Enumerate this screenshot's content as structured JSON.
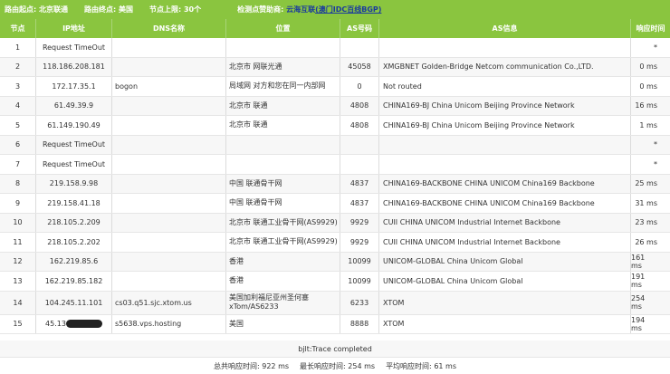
{
  "topbar": {
    "start_label": "路由起点: 北京联通",
    "end_label": "路由终点: 美国",
    "nodes_label": "节点上限: 30个",
    "sponsor_prefix": "检测点赞助商:",
    "sponsor_name": "云海互联",
    "sponsor_desc": "(澳门IDC百线BGP)"
  },
  "headers": [
    "节点",
    "IP地址",
    "DNS名称",
    "位置",
    "AS号码",
    "AS信息",
    "响应时间"
  ],
  "rows": [
    {
      "hop": "1",
      "ip": "Request TimeOut",
      "dns": "",
      "location": "",
      "as": "",
      "asinfo": "",
      "time": "*"
    },
    {
      "hop": "2",
      "ip": "118.186.208.181",
      "dns": "",
      "location": "北京市 网联光通",
      "as": "45058",
      "asinfo": "XMGBNET Golden-Bridge Netcom communication Co.,LTD.",
      "time": "0 ms"
    },
    {
      "hop": "3",
      "ip": "172.17.35.1",
      "dns": "bogon",
      "location": "局域网 对方和您在同一内部网",
      "as": "0",
      "asinfo": "Not routed",
      "time": "0 ms"
    },
    {
      "hop": "4",
      "ip": "61.49.39.9",
      "dns": "",
      "location": "北京市 联通",
      "as": "4808",
      "asinfo": "CHINA169-BJ China Unicom Beijing Province Network",
      "time": "16 ms"
    },
    {
      "hop": "5",
      "ip": "61.149.190.49",
      "dns": "",
      "location": "北京市 联通",
      "as": "4808",
      "asinfo": "CHINA169-BJ China Unicom Beijing Province Network",
      "time": "1 ms"
    },
    {
      "hop": "6",
      "ip": "Request TimeOut",
      "dns": "",
      "location": "",
      "as": "",
      "asinfo": "",
      "time": "*"
    },
    {
      "hop": "7",
      "ip": "Request TimeOut",
      "dns": "",
      "location": "",
      "as": "",
      "asinfo": "",
      "time": "*"
    },
    {
      "hop": "8",
      "ip": "219.158.9.98",
      "dns": "",
      "location": "中国 联通骨干网",
      "as": "4837",
      "asinfo": "CHINA169-BACKBONE CHINA UNICOM China169 Backbone",
      "time": "25 ms"
    },
    {
      "hop": "9",
      "ip": "219.158.41.18",
      "dns": "",
      "location": "中国 联通骨干网",
      "as": "4837",
      "asinfo": "CHINA169-BACKBONE CHINA UNICOM China169 Backbone",
      "time": "31 ms"
    },
    {
      "hop": "10",
      "ip": "218.105.2.209",
      "dns": "",
      "location": "北京市 联通工业骨干网(AS9929)",
      "as": "9929",
      "asinfo": "CUII CHINA UNICOM Industrial Internet Backbone",
      "time": "23 ms"
    },
    {
      "hop": "11",
      "ip": "218.105.2.202",
      "dns": "",
      "location": "北京市 联通工业骨干网(AS9929)",
      "as": "9929",
      "asinfo": "CUII CHINA UNICOM Industrial Internet Backbone",
      "time": "26 ms"
    },
    {
      "hop": "12",
      "ip": "162.219.85.6",
      "dns": "",
      "location": "香港",
      "as": "10099",
      "asinfo": "UNICOM-GLOBAL China Unicom Global",
      "time": "161 ms"
    },
    {
      "hop": "13",
      "ip": "162.219.85.182",
      "dns": "",
      "location": "香港",
      "as": "10099",
      "asinfo": "UNICOM-GLOBAL China Unicom Global",
      "time": "191 ms"
    },
    {
      "hop": "14",
      "ip": "104.245.11.101",
      "dns": "cs03.q51.sjc.xtom.us",
      "location": "美国加利福尼亚州圣何塞 xTom/AS6233",
      "as": "6233",
      "asinfo": "XTOM",
      "time": "254 ms"
    },
    {
      "hop": "15",
      "ip": "45.13",
      "dns": "s5638.vps.hosting",
      "location": "美国",
      "as": "8888",
      "asinfo": "XTOM",
      "time": "194 ms"
    }
  ],
  "footer": {
    "trace_status": "bjlt:Trace completed",
    "total_label": "总共响应时间:",
    "total_value": "922 ms",
    "max_label": "最长响应时间:",
    "max_value": "254 ms",
    "avg_label": "平均响应时间:",
    "avg_value": "61 ms"
  },
  "colors": {
    "header_green": "#8ac53f",
    "sponsor_blue": "#1a3a9e"
  }
}
